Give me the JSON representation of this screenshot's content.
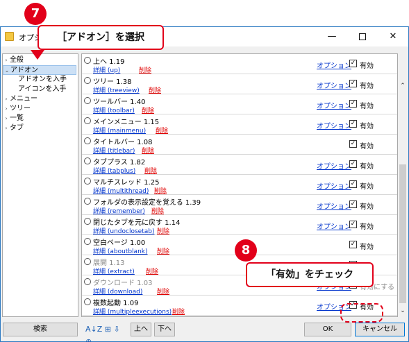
{
  "window": {
    "title": "オプショ",
    "min_glyph": "—",
    "close_glyph": "✕"
  },
  "annotations": {
    "step7_number": "7",
    "step7_text": "［アドオン］を選択",
    "step8_number": "8",
    "step8_text": "「有効」をチェック"
  },
  "tree": {
    "items": [
      {
        "label": "全般",
        "arrow": "›"
      },
      {
        "label": "アドオン",
        "arrow": "⌄"
      },
      {
        "label": "アドオンを入手",
        "arrow": ""
      },
      {
        "label": "アイコンを入手",
        "arrow": ""
      },
      {
        "label": "メニュー",
        "arrow": "›"
      },
      {
        "label": "ツリー",
        "arrow": "›"
      },
      {
        "label": "一覧",
        "arrow": "›"
      },
      {
        "label": "タブ",
        "arrow": "›"
      }
    ]
  },
  "addons": [
    {
      "name": "上へ 1.19",
      "detail": "詳細 (up)",
      "delete": "削除",
      "option": "オプション",
      "enabled_label": "有効",
      "checked": true,
      "grey": false
    },
    {
      "name": "ツリー 1.38",
      "detail": "詳細 (treeview)",
      "delete": "削除",
      "option": "オプション",
      "enabled_label": "有効",
      "checked": true,
      "grey": false
    },
    {
      "name": "ツールバー 1.40",
      "detail": "詳細 (toolbar)",
      "delete": "削除",
      "option": "オプション",
      "enabled_label": "有効",
      "checked": true,
      "grey": false
    },
    {
      "name": "メインメニュー 1.15",
      "detail": "詳細 (mainmenu)",
      "delete": "削除",
      "option": "オプション",
      "enabled_label": "有効",
      "checked": true,
      "grey": false
    },
    {
      "name": "タイトルバー 1.08",
      "detail": "詳細 (titlebar)",
      "delete": "削除",
      "option": "",
      "enabled_label": "有効",
      "checked": true,
      "grey": false
    },
    {
      "name": "タブプラス 1.82",
      "detail": "詳細 (tabplus)",
      "delete": "削除",
      "option": "オプション",
      "enabled_label": "有効",
      "checked": true,
      "grey": false
    },
    {
      "name": "マルチスレッド 1.25",
      "detail": "詳細 (multithread)",
      "delete": "削除",
      "option": "オプション",
      "enabled_label": "有効",
      "checked": true,
      "grey": false
    },
    {
      "name": "フォルダの表示設定を覚える 1.39",
      "detail": "詳細 (remember)",
      "delete": "削除",
      "option": "オプション",
      "enabled_label": "有効",
      "checked": true,
      "grey": false
    },
    {
      "name": "閉じたタブを元に戻す 1.14",
      "detail": "詳細 (undoclosetab)",
      "delete": "削除",
      "option": "オプション",
      "enabled_label": "有効",
      "checked": true,
      "grey": false
    },
    {
      "name": "空白ページ 1.00",
      "detail": "詳細 (aboutblank)",
      "delete": "削除",
      "option": "",
      "enabled_label": "有効",
      "checked": true,
      "grey": false
    },
    {
      "name": "展開 1.13",
      "detail": "詳細 (extract)",
      "delete": "削除",
      "option": "",
      "enabled_label": "する",
      "checked": false,
      "grey": true
    },
    {
      "name": "ダウンロード 1.03",
      "detail": "詳細 (download)",
      "delete": "削除",
      "option": "オプション",
      "enabled_label": "有効にする",
      "checked": false,
      "grey": true
    },
    {
      "name": "複数起動 1.09",
      "detail": "詳細 (multipleexecutions)",
      "delete": "削除",
      "option": "オプション",
      "enabled_label": "有効",
      "checked": true,
      "grey": false
    }
  ],
  "buttons": {
    "search": "検索",
    "up": "上へ",
    "down": "下へ",
    "ok": "OK",
    "cancel": "キャンセル",
    "sort_icons": "A↓Z ⊞ ⇩ ⊕"
  },
  "scroll": {
    "up_glyph": "⌃",
    "down_glyph": "⌄"
  }
}
